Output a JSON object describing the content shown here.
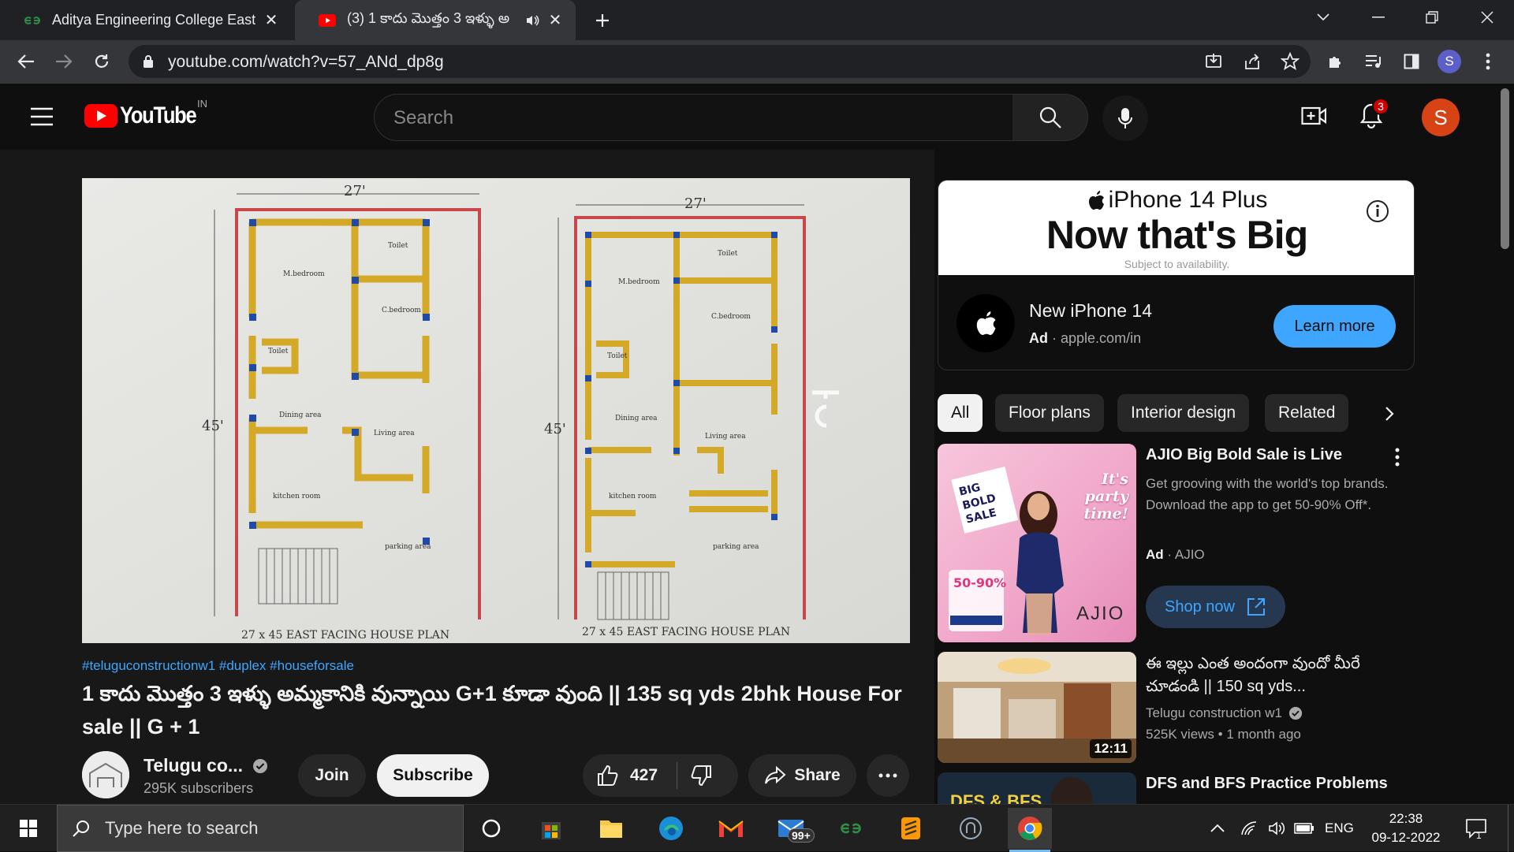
{
  "browser": {
    "tabs": [
      {
        "title": "Aditya Engineering College East Go",
        "active": false
      },
      {
        "title": "(3) 1 కాదు మొత్తం 3 ఇళ్ళు అ",
        "active": true
      }
    ],
    "url": "youtube.com/watch?v=57_ANd_dp8g"
  },
  "youtube": {
    "logo_text": "YouTube",
    "region": "IN",
    "search_placeholder": "Search",
    "notification_count": "3",
    "avatar_letter": "S"
  },
  "video": {
    "hashtags": "#teluguconstructionw1 #duplex #houseforsale",
    "title": "1 కాదు మొత్తం 3 ఇళ్ళు అమ్మకానికి వున్నాయి G+1 కూడా వుంది || 135 sq yds 2bhk House For sale || G + 1",
    "channel_name": "Telugu co...",
    "subscribers": "295K subscribers",
    "join_label": "Join",
    "subscribe_label": "Subscribe",
    "likes": "427",
    "share_label": "Share",
    "plan": {
      "left_caption": "27 x 45 EAST FACING HOUSE PLAN",
      "right_caption": "27 x 45 EAST FACING HOUSE PLAN",
      "dim_width": "27'",
      "dim_height": "45'",
      "left_rooms": [
        "M.bedroom",
        "Toilet",
        "C.bedroom",
        "Toilet",
        "Dining area",
        "Living area",
        "kitchen room",
        "parking area"
      ],
      "right_rooms": [
        "M.bedroom",
        "Toilet",
        "C.bedroom",
        "Toilet",
        "Dining area",
        "Living area",
        "kitchen room",
        "parking area"
      ]
    }
  },
  "ad_banner": {
    "product": "iPhone 14 Plus",
    "headline": "Now that's Big",
    "fineprint": "Subject to availability.",
    "title": "New iPhone 14",
    "ad_label": "Ad",
    "domain": "apple.com/in",
    "cta": "Learn more"
  },
  "chips": [
    "All",
    "Floor plans",
    "Interior design",
    "Related"
  ],
  "sidebar": [
    {
      "type": "ad",
      "title": "AJIO Big Bold Sale is Live",
      "desc": "Get grooving with the world's top brands. Download the app to get 50-90% Off*.",
      "ad_label": "Ad",
      "advertiser": "AJIO",
      "cta": "Shop now",
      "thumb_text1": "It's party time!",
      "thumb_brand": "AJIO",
      "thumb_badge": "50-90%"
    },
    {
      "type": "video",
      "title": "ఈ ఇల్లు ఎంత అందంగా వుందో మీరే చూడండి || 150 sq yds...",
      "channel": "Telugu construction w1",
      "views": "525K views",
      "age": "1 month ago",
      "duration": "12:11"
    },
    {
      "type": "video",
      "title": "DFS and BFS Practice Problems",
      "thumb_text": "DFS & BFS"
    }
  ],
  "taskbar": {
    "search_placeholder": "Type here to search",
    "mail_badge": "99+",
    "lang": "ENG",
    "time": "22:38",
    "date": "09-12-2022",
    "notif_count": "1"
  }
}
